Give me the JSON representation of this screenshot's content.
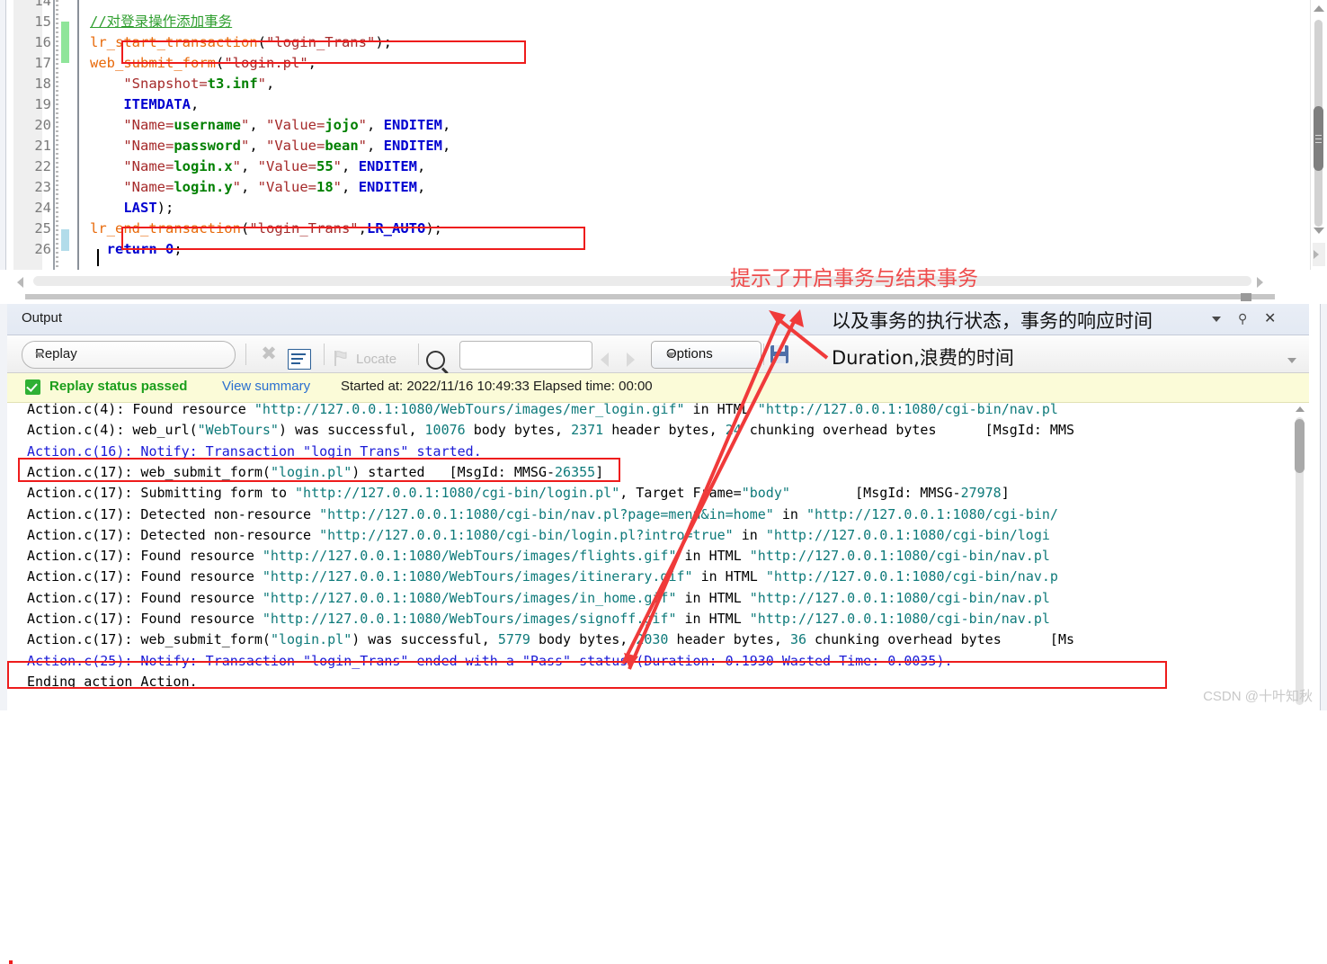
{
  "editor": {
    "lines": [
      {
        "no": "14",
        "blank": true
      },
      {
        "no": "15",
        "text": "//对登录操作添加事务"
      },
      {
        "no": "16",
        "text": "lr_start_transaction(\"login_Trans\");"
      },
      {
        "no": "17",
        "text": "web_submit_form(\"login.pl\","
      },
      {
        "no": "18",
        "text": "\"Snapshot=t3.inf\","
      },
      {
        "no": "19",
        "text": "ITEMDATA,"
      },
      {
        "no": "20",
        "text": "\"Name=username\", \"Value=jojo\", ENDITEM,"
      },
      {
        "no": "21",
        "text": "\"Name=password\", \"Value=bean\", ENDITEM,"
      },
      {
        "no": "22",
        "text": "\"Name=login.x\", \"Value=55\", ENDITEM,"
      },
      {
        "no": "23",
        "text": "\"Name=login.y\", \"Value=18\", ENDITEM,"
      },
      {
        "no": "24",
        "text": "LAST);"
      },
      {
        "no": "25",
        "text": "lr_end_transaction(\"login_Trans\",LR_AUTO);"
      },
      {
        "no": "26",
        "text": "return 0;"
      }
    ]
  },
  "output": {
    "title": "Output",
    "toolbar": {
      "source_select": "Replay",
      "clear_label": "clear-icon",
      "wrap_label": "wrap-icon",
      "locate_label": "Locate",
      "search_value": "",
      "search_placeholder": "",
      "options_label": "Options",
      "save_label": "save-icon"
    },
    "status": {
      "state": "Replay status passed",
      "link": "View summary",
      "meta": "Started at: 2022/11/16 10:49:33 Elapsed time: 00:00"
    },
    "log_lines": [
      {
        "id": "l1",
        "segs": [
          {
            "t": "Action.c(4): Found resource ",
            "c": "k"
          },
          {
            "t": "\"http://127.0.0.1:1080/WebTours/images/mer_login.gif\"",
            "c": "t"
          },
          {
            "t": " in HTML ",
            "c": "k"
          },
          {
            "t": "\"http://127.0.0.1:1080/cgi-bin/nav.pl",
            "c": "t"
          }
        ]
      },
      {
        "id": "l2",
        "segs": [
          {
            "t": "Action.c(4): web_url(",
            "c": "k"
          },
          {
            "t": "\"WebTours\"",
            "c": "t"
          },
          {
            "t": ") was successful, ",
            "c": "k"
          },
          {
            "t": "10076",
            "c": "t"
          },
          {
            "t": " body bytes, ",
            "c": "k"
          },
          {
            "t": "2371",
            "c": "t"
          },
          {
            "t": " header bytes, ",
            "c": "k"
          },
          {
            "t": "24",
            "c": "t"
          },
          {
            "t": " chunking overhead bytes      [MsgId: MMS",
            "c": "k"
          }
        ]
      },
      {
        "id": "l3",
        "segs": [
          {
            "t": "Action.c(16): Notify: Transaction \"login_Trans\" started.",
            "c": "b"
          }
        ]
      },
      {
        "id": "l4",
        "segs": [
          {
            "t": "Action.c(17): web_submit_form(",
            "c": "k"
          },
          {
            "t": "\"login.pl\"",
            "c": "t"
          },
          {
            "t": ") started   [MsgId: MMSG-",
            "c": "k"
          },
          {
            "t": "26355",
            "c": "t"
          },
          {
            "t": "]",
            "c": "k"
          }
        ]
      },
      {
        "id": "l5",
        "segs": [
          {
            "t": "Action.c(17): Submitting form to ",
            "c": "k"
          },
          {
            "t": "\"http://127.0.0.1:1080/cgi-bin/login.pl\"",
            "c": "t"
          },
          {
            "t": ", Target Frame=",
            "c": "k"
          },
          {
            "t": "\"body\"",
            "c": "t"
          },
          {
            "t": "        [MsgId: MMSG-",
            "c": "k"
          },
          {
            "t": "27978",
            "c": "t"
          },
          {
            "t": "]",
            "c": "k"
          }
        ]
      },
      {
        "id": "l6",
        "segs": [
          {
            "t": "Action.c(17): Detected non-resource ",
            "c": "k"
          },
          {
            "t": "\"http://127.0.0.1:1080/cgi-bin/nav.pl?page=menu&in=home\"",
            "c": "t"
          },
          {
            "t": " in ",
            "c": "k"
          },
          {
            "t": "\"http://127.0.0.1:1080/cgi-bin/",
            "c": "t"
          }
        ]
      },
      {
        "id": "l7",
        "segs": [
          {
            "t": "Action.c(17): Detected non-resource ",
            "c": "k"
          },
          {
            "t": "\"http://127.0.0.1:1080/cgi-bin/login.pl?intro=true\"",
            "c": "t"
          },
          {
            "t": " in ",
            "c": "k"
          },
          {
            "t": "\"http://127.0.0.1:1080/cgi-bin/logi",
            "c": "t"
          }
        ]
      },
      {
        "id": "l8",
        "segs": [
          {
            "t": "Action.c(17): Found resource ",
            "c": "k"
          },
          {
            "t": "\"http://127.0.0.1:1080/WebTours/images/flights.gif\"",
            "c": "t"
          },
          {
            "t": " in HTML ",
            "c": "k"
          },
          {
            "t": "\"http://127.0.0.1:1080/cgi-bin/nav.pl",
            "c": "t"
          }
        ]
      },
      {
        "id": "l9",
        "segs": [
          {
            "t": "Action.c(17): Found resource ",
            "c": "k"
          },
          {
            "t": "\"http://127.0.0.1:1080/WebTours/images/itinerary.gif\"",
            "c": "t"
          },
          {
            "t": " in HTML ",
            "c": "k"
          },
          {
            "t": "\"http://127.0.0.1:1080/cgi-bin/nav.p",
            "c": "t"
          }
        ]
      },
      {
        "id": "l10",
        "segs": [
          {
            "t": "Action.c(17): Found resource ",
            "c": "k"
          },
          {
            "t": "\"http://127.0.0.1:1080/WebTours/images/in_home.gif\"",
            "c": "t"
          },
          {
            "t": " in HTML ",
            "c": "k"
          },
          {
            "t": "\"http://127.0.0.1:1080/cgi-bin/nav.pl",
            "c": "t"
          }
        ]
      },
      {
        "id": "l11",
        "segs": [
          {
            "t": "Action.c(17): Found resource ",
            "c": "k"
          },
          {
            "t": "\"http://127.0.0.1:1080/WebTours/images/signoff.gif\"",
            "c": "t"
          },
          {
            "t": " in HTML ",
            "c": "k"
          },
          {
            "t": "\"http://127.0.0.1:1080/cgi-bin/nav.pl",
            "c": "t"
          }
        ]
      },
      {
        "id": "l12",
        "segs": [
          {
            "t": "Action.c(17): web_submit_form(",
            "c": "k"
          },
          {
            "t": "\"login.pl\"",
            "c": "t"
          },
          {
            "t": ") was successful, ",
            "c": "k"
          },
          {
            "t": "5779",
            "c": "t"
          },
          {
            "t": " body bytes, ",
            "c": "k"
          },
          {
            "t": "2030",
            "c": "t"
          },
          {
            "t": " header bytes, ",
            "c": "k"
          },
          {
            "t": "36",
            "c": "t"
          },
          {
            "t": " chunking overhead bytes      [Ms",
            "c": "k"
          }
        ]
      },
      {
        "id": "l13",
        "segs": [
          {
            "t": "Action.c(25): Notify: Transaction \"login_Trans\" ended with a \"Pass\" status (Duration: 0.1930 Wasted Time: 0.0035).",
            "c": "b"
          }
        ]
      },
      {
        "id": "l14",
        "segs": [
          {
            "t": "Ending action Action.",
            "c": "k"
          }
        ]
      }
    ]
  },
  "annotations": {
    "note_start_end": "提示了开启事务与结束事务",
    "note_state": "以及事务的执行状态，事务的响应时间",
    "note_duration": "Duration,浪费的时间"
  },
  "watermark": "CSDN @十叶知秋",
  "colors": {
    "highlight_box": "#ee1c1c",
    "annotation_text": "#ee4b4b",
    "status_pass": "#1b9e1b",
    "link": "#2a6fd0",
    "log_string": "#0e7a7a",
    "log_transaction": "#1a1ad6",
    "status_bg": "#fbfbd8"
  }
}
